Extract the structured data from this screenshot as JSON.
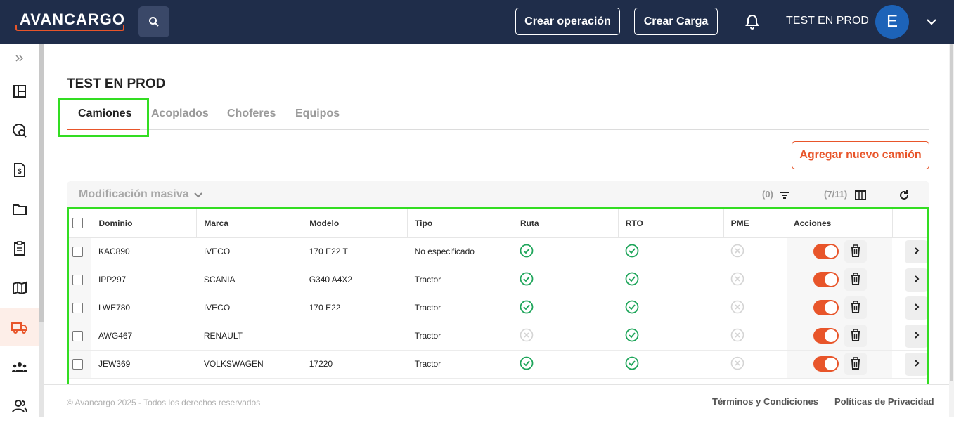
{
  "topbar": {
    "logo_text": "AVANCARGO",
    "search_icon": "search-icon",
    "create_operation": "Crear operación",
    "create_load": "Crear Carga",
    "user_name": "TEST EN PROD",
    "avatar_initial": "E"
  },
  "sidebar": {
    "items": [
      "expand-icon",
      "dashboard-icon",
      "tracking-icon",
      "invoice-icon",
      "folder-icon",
      "clipboard-icon",
      "map-icon",
      "truck-icon",
      "team-icon",
      "users-icon"
    ],
    "active": "truck-icon"
  },
  "page": {
    "title": "TEST EN PROD",
    "tabs": [
      {
        "label": "Camiones",
        "active": true
      },
      {
        "label": "Acoplados",
        "active": false
      },
      {
        "label": "Choferes",
        "active": false
      },
      {
        "label": "Equipos",
        "active": false
      }
    ],
    "add_button": "Agregar nuevo camión"
  },
  "toolbar": {
    "bulk_edit": "Modificación masiva",
    "filter_count": "(0)",
    "columns_count": "(7/11)"
  },
  "table": {
    "headers": [
      "Dominio",
      "Marca",
      "Modelo",
      "Tipo",
      "Ruta",
      "RTO",
      "PME",
      "Acciones"
    ],
    "rows": [
      {
        "dominio": "KAC890",
        "marca": "IVECO",
        "modelo": "170 E22 T",
        "tipo": "No especificado",
        "ruta": true,
        "rto": true,
        "pme": false
      },
      {
        "dominio": "IPP297",
        "marca": "SCANIA",
        "modelo": "G340 A4X2",
        "tipo": "Tractor",
        "ruta": true,
        "rto": true,
        "pme": false
      },
      {
        "dominio": "LWE780",
        "marca": "IVECO",
        "modelo": "170 E22",
        "tipo": "Tractor",
        "ruta": true,
        "rto": true,
        "pme": false
      },
      {
        "dominio": "AWG467",
        "marca": "RENAULT",
        "modelo": "",
        "tipo": "Tractor",
        "ruta": false,
        "rto": true,
        "pme": false
      },
      {
        "dominio": "JEW369",
        "marca": "VOLKSWAGEN",
        "modelo": "17220",
        "tipo": "Tractor",
        "ruta": true,
        "rto": true,
        "pme": false
      }
    ]
  },
  "footer": {
    "copyright": "© Avancargo 2025 - Todos los derechos reservados",
    "terms": "Términos y Condiciones",
    "privacy": "Políticas de Privacidad"
  },
  "colors": {
    "topbar": "#1f2d4a",
    "accent": "#e8552a",
    "check_green": "#1ea55a",
    "highlight": "#33dd22"
  }
}
